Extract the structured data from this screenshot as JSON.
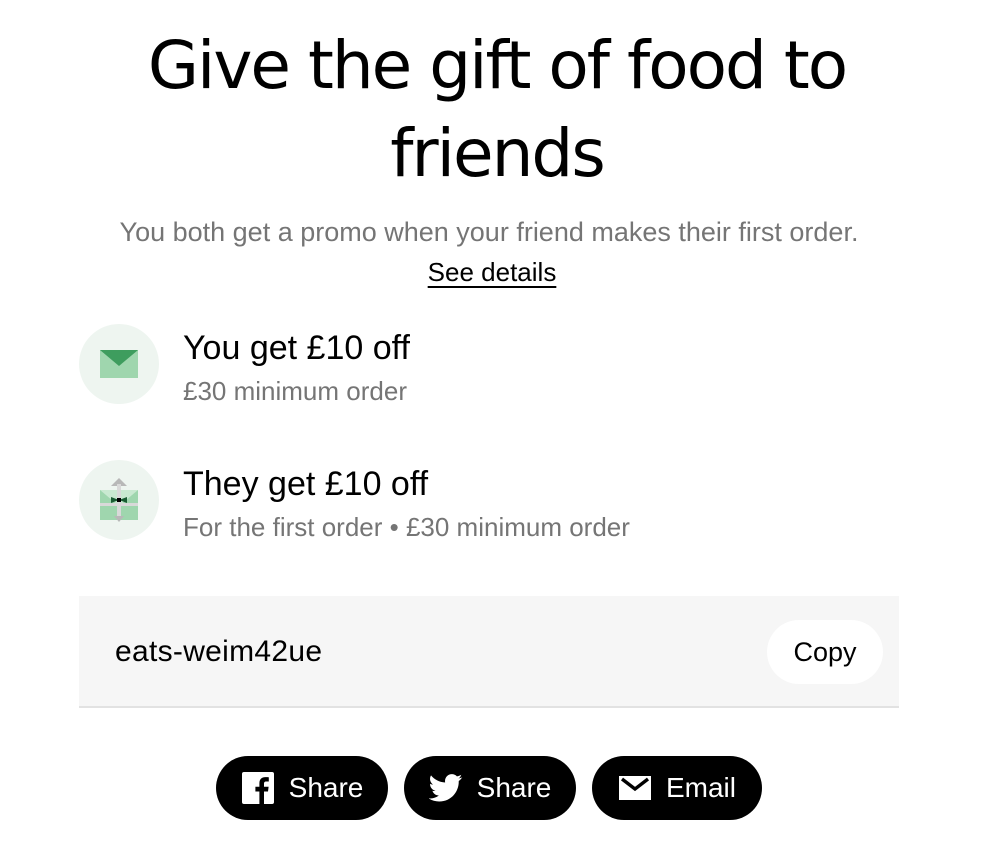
{
  "headline": {
    "line1": "Give the gift of food to",
    "line2": "friends"
  },
  "subtitle": "You both get a promo when your friend makes their first order.",
  "details_link": "See details",
  "benefits": [
    {
      "title": "You get £10 off",
      "subtitle": "£30 minimum order",
      "icon": "envelope-icon"
    },
    {
      "title": "They get £10 off",
      "subtitle": "For the first order • £30 minimum order",
      "icon": "gift-envelope-icon"
    }
  ],
  "promo": {
    "code": "eats-weim42ue",
    "copy_label": "Copy"
  },
  "share": {
    "facebook": {
      "label": "Share",
      "icon": "facebook-icon"
    },
    "twitter": {
      "label": "Share",
      "icon": "twitter-icon"
    },
    "email": {
      "label": "Email",
      "icon": "mail-icon"
    }
  },
  "colors": {
    "accent_green": "#5fb37a",
    "icon_bg": "#eef5f0",
    "muted_text": "#757575",
    "button_black": "#000000",
    "code_bg": "#f6f6f6"
  }
}
